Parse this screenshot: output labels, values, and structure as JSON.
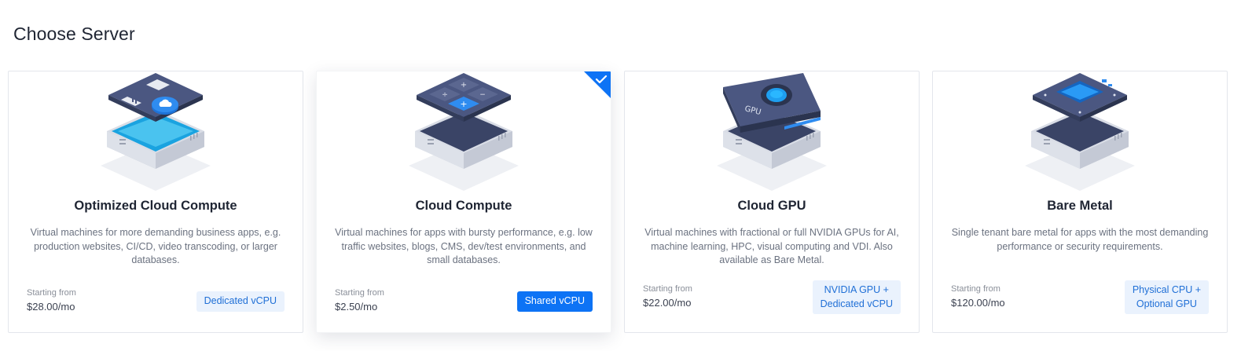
{
  "page": {
    "title": "Choose Server"
  },
  "cards": [
    {
      "name": "Optimized Cloud Compute",
      "description": "Virtual machines for more demanding business apps, e.g. production websites, CI/CD, video transcoding, or larger databases.",
      "starting_label": "Starting from",
      "price": "$28.00/mo",
      "badge_line1": "Dedicated vCPU",
      "badge_line2": "",
      "selected": false
    },
    {
      "name": "Cloud Compute",
      "description": "Virtual machines for apps with bursty performance, e.g. low traffic websites, blogs, CMS, dev/test environments, and small databases.",
      "starting_label": "Starting from",
      "price": "$2.50/mo",
      "badge_line1": "Shared vCPU",
      "badge_line2": "",
      "selected": true
    },
    {
      "name": "Cloud GPU",
      "description": "Virtual machines with fractional or full NVIDIA GPUs for AI, machine learning, HPC, visual computing and VDI. Also available as Bare Metal.",
      "starting_label": "Starting from",
      "price": "$22.00/mo",
      "badge_line1": "NVIDIA GPU +",
      "badge_line2": "Dedicated vCPU",
      "selected": false,
      "art_label": "GPU"
    },
    {
      "name": "Bare Metal",
      "description": "Single tenant bare metal for apps with the most demanding performance or security requirements.",
      "starting_label": "Starting from",
      "price": "$120.00/mo",
      "badge_line1": "Physical CPU +",
      "badge_line2": "Optional GPU",
      "selected": false
    }
  ],
  "colors": {
    "accent": "#0d73f5",
    "badge_bg": "#eaf2fd",
    "badge_text": "#1f6fd6",
    "board_dark": "#3e4a6b",
    "board_top": "#4b5781"
  },
  "icons": [
    "server-compute-cloud-icon",
    "server-calculator-icon",
    "gpu-card-icon",
    "bare-metal-chip-icon",
    "checkmark-icon"
  ]
}
